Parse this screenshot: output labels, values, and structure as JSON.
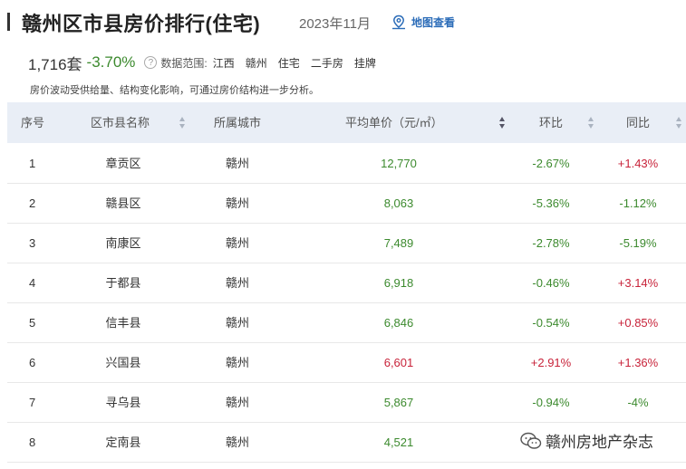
{
  "header": {
    "title": "赣州区市县房价排行(住宅)",
    "date": "2023年11月",
    "map_link": "地图查看"
  },
  "summary": {
    "count": "1,716套",
    "change": "-3.70%",
    "help_icon": "?",
    "scope_label": "数据范围:",
    "tags": [
      "江西",
      "赣州",
      "住宅",
      "二手房",
      "挂牌"
    ]
  },
  "note": "房价波动受供给量、结构变化影响，可通过房价结构进一步分析。",
  "table": {
    "columns": [
      "序号",
      "区市县名称",
      "所属城市",
      "平均单价（元/㎡）",
      "环比",
      "同比"
    ],
    "rows": [
      {
        "rank": "1",
        "name": "章贡区",
        "city": "赣州",
        "price": "12,770",
        "mom": "-2.67%",
        "yoy": "+1.43%"
      },
      {
        "rank": "2",
        "name": "赣县区",
        "city": "赣州",
        "price": "8,063",
        "mom": "-5.36%",
        "yoy": "-1.12%"
      },
      {
        "rank": "3",
        "name": "南康区",
        "city": "赣州",
        "price": "7,489",
        "mom": "-2.78%",
        "yoy": "-5.19%"
      },
      {
        "rank": "4",
        "name": "于都县",
        "city": "赣州",
        "price": "6,918",
        "mom": "-0.46%",
        "yoy": "+3.14%"
      },
      {
        "rank": "5",
        "name": "信丰县",
        "city": "赣州",
        "price": "6,846",
        "mom": "-0.54%",
        "yoy": "+0.85%"
      },
      {
        "rank": "6",
        "name": "兴国县",
        "city": "赣州",
        "price": "6,601",
        "mom": "+2.91%",
        "yoy": "+1.36%"
      },
      {
        "rank": "7",
        "name": "寻乌县",
        "city": "赣州",
        "price": "5,867",
        "mom": "-0.94%",
        "yoy": "-4%"
      },
      {
        "rank": "8",
        "name": "定南县",
        "city": "赣州",
        "price": "4,521",
        "mom": "",
        "yoy": ""
      }
    ]
  },
  "watermark": "赣州房地产杂志",
  "colors": {
    "positive": "#c8233a",
    "negative": "#3c8a2e",
    "header_bg": "#e9eef6",
    "link": "#2b6cb8"
  },
  "icons": {
    "map": "map-pin-icon",
    "sort": "sort-icon",
    "help": "question-circle-icon",
    "watermark": "wechat-icon"
  }
}
